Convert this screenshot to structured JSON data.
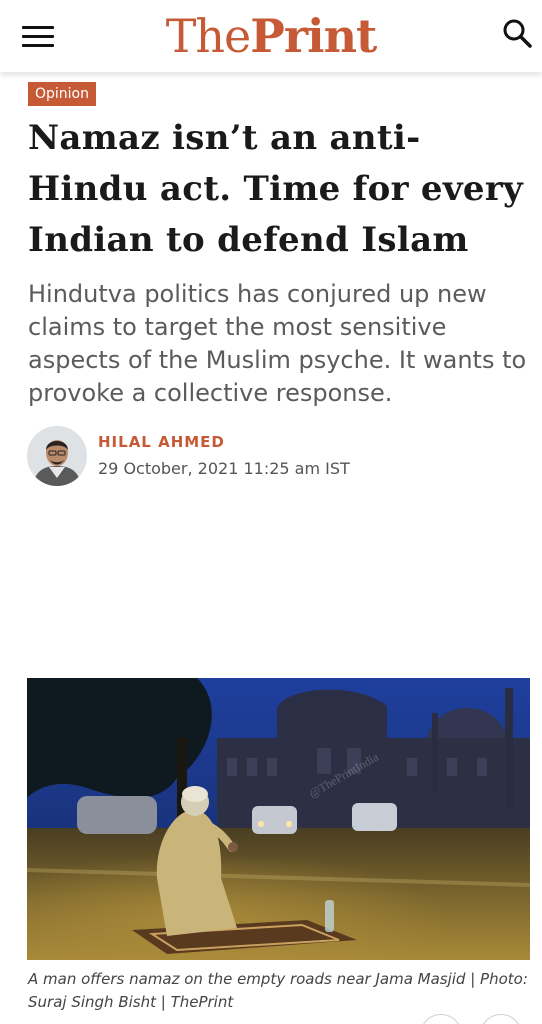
{
  "header": {
    "logo_part1": "The",
    "logo_part2": "Print",
    "brand_color": "#c75a36"
  },
  "article": {
    "category": "Opinion",
    "headline": "Namaz isn’t an anti-Hindu act. Time for every Indian to defend Islam",
    "dek": "Hindutva politics has conjured up new claims to target the most sensitive aspects of the Muslim psyche. It wants to provoke a collective response.",
    "author": "HILAL AHMED",
    "date": "29 October, 2021 11:25 am IST",
    "image_caption": "A man offers namaz on the empty roads near Jama Masjid | Photo: Suraj Singh Bisht | ThePrint",
    "image_watermark": "@ThePrintIndia"
  },
  "icons": {
    "menu": "hamburger-menu-icon",
    "search": "search-icon"
  }
}
